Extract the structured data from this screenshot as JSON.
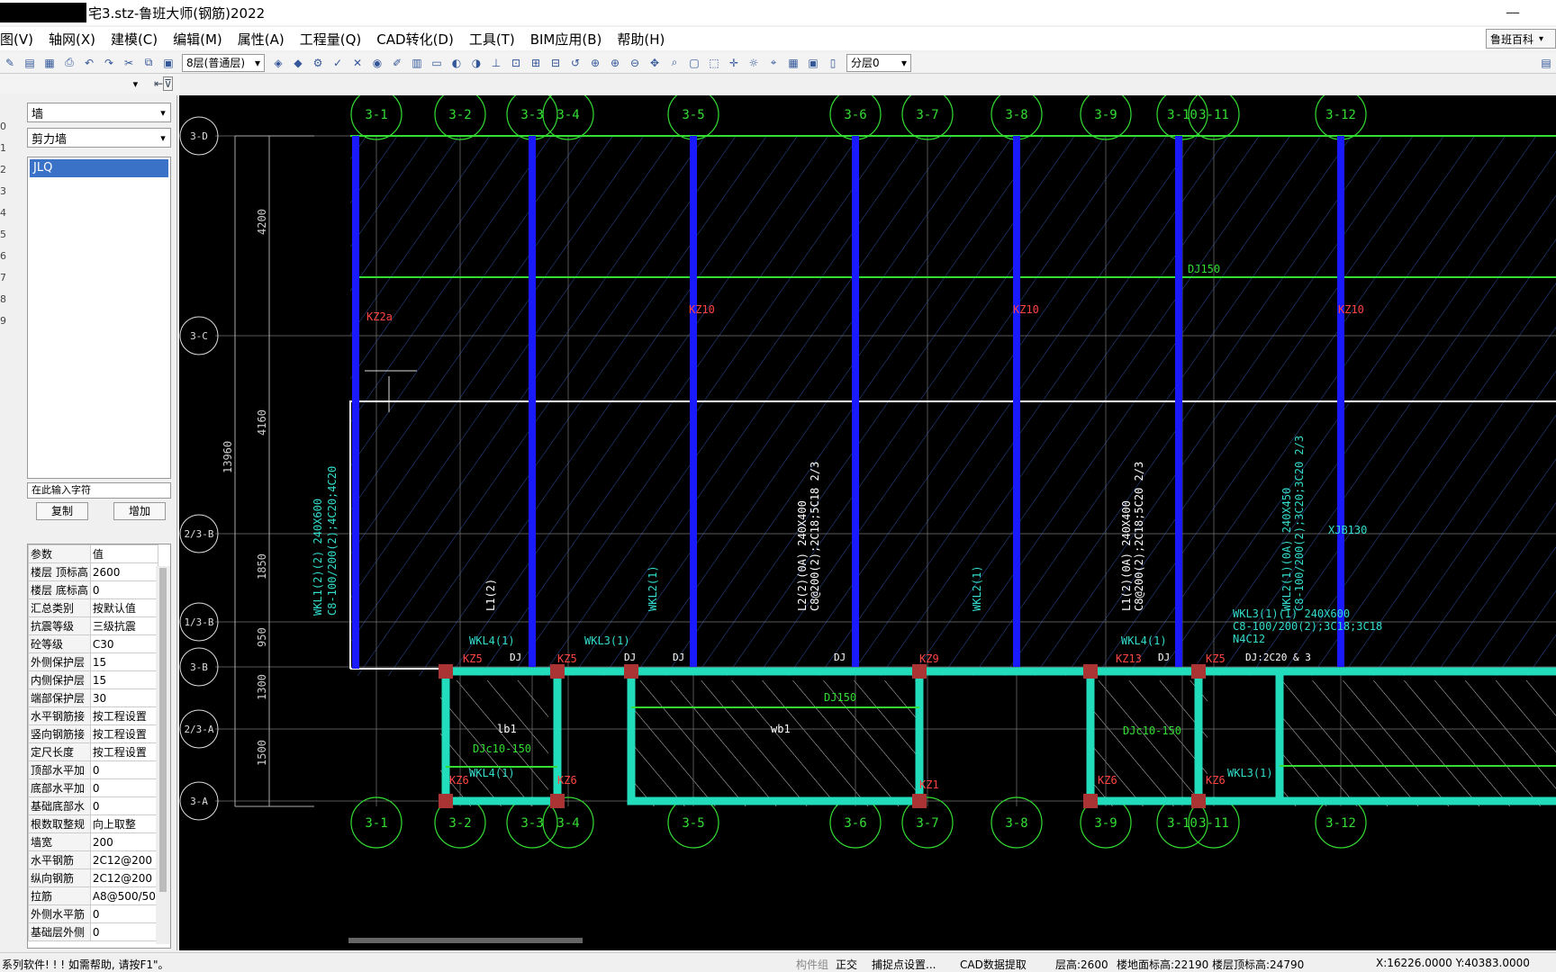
{
  "window": {
    "title": "宅3.stz-鲁班大师(钢筋)2022",
    "minimize": "—"
  },
  "menu": [
    "图(V)",
    "轴网(X)",
    "建模(C)",
    "编辑(M)",
    "属性(A)",
    "工程量(Q)",
    "CAD转化(D)",
    "工具(T)",
    "BIM应用(B)",
    "帮助(H)"
  ],
  "help_center": "鲁班百科",
  "toolbar": {
    "floor": "8层(普通层)",
    "layer": "分层0"
  },
  "left_strip": [
    "0",
    "1",
    "2",
    "3",
    "4",
    "5",
    "6",
    "7",
    "8",
    "9"
  ],
  "panel": {
    "type": "墙",
    "subtype": "剪力墙",
    "selected_item": "JLQ",
    "search_placeholder": "在此输入字符",
    "copy_btn": "复制",
    "add_btn": "增加",
    "props_header": [
      "参数",
      "值"
    ],
    "props": [
      [
        "楼层 顶标高",
        "2600"
      ],
      [
        "楼层 底标高",
        "0"
      ],
      [
        "汇总类别",
        "按默认值"
      ],
      [
        "抗震等级",
        "三级抗震"
      ],
      [
        "砼等级",
        "C30"
      ],
      [
        "外侧保护层",
        "15"
      ],
      [
        "内侧保护层",
        "15"
      ],
      [
        "端部保护层",
        "30"
      ],
      [
        "水平钢筋接",
        "按工程设置"
      ],
      [
        "竖向钢筋接",
        "按工程设置"
      ],
      [
        "定尺长度",
        "按工程设置"
      ],
      [
        "顶部水平加",
        "0"
      ],
      [
        "底部水平加",
        "0"
      ],
      [
        "基础底部水",
        "0"
      ],
      [
        "根数取整规",
        "向上取整"
      ],
      [
        "墙宽",
        "200"
      ],
      [
        "水平钢筋",
        "2C12@200"
      ],
      [
        "纵向钢筋",
        "2C12@200"
      ],
      [
        "拉筋",
        "A8@500/50"
      ],
      [
        "外侧水平筋",
        "0"
      ],
      [
        "基础层外侧",
        "0"
      ]
    ]
  },
  "cad": {
    "top_axes": [
      "3-1",
      "3-2",
      "3-3",
      "3-4",
      "3-5",
      "3-6",
      "3-7",
      "3-8",
      "3-9",
      "3-10",
      "3-11",
      "3-12"
    ],
    "left_axes": [
      "3-D",
      "3-C",
      "2/3-B",
      "1/3-B",
      "3-B",
      "2/3-A",
      "3-A"
    ],
    "dims": [
      "4200",
      "4160",
      "13960",
      "1850",
      "950",
      "1300",
      "1500"
    ],
    "labels": {
      "dj150": "DJ150",
      "kz2a": "KZ2a",
      "kz10": "KZ10",
      "xjb130": "XJB130",
      "wkl1": "WKL1(2)(2) 240X600",
      "wkl1b": "C8-100/200(2);4C20;4C20",
      "l1": "L1(2)",
      "wkl2": "WKL2(1)",
      "l2": "L2(2)(0A) 240X400",
      "l2b": "C8@200(2);2C18;5C18 2/3",
      "l1b": "L1(2)(0A) 240X400",
      "l1c": "C8@200(2);2C18;5C20 2/3",
      "wkl2b": "WKL2(1)(0A) 240X450",
      "wkl2c": "C8-100/200(2);3C20;3C20 2/3",
      "wkl3": "WKL3(1)(1) 240X600",
      "wkl3b": "C8-100/200(2);3C18;3C18",
      "n4c12": "N4C12",
      "wkl4": "WKL4(1)",
      "wkl3s": "WKL3(1)",
      "kz5": "KZ5",
      "kz6": "KZ6",
      "kz9": "KZ9",
      "kz1": "KZ1",
      "kz13": "KZ13",
      "dj": "DJ",
      "dj2": "DJ:2C20 & 3",
      "lb1": "lb1",
      "wb1": "wb1",
      "djc": "DJc10-150",
      "djc2": "DJc10-150"
    }
  },
  "status": {
    "msg": "系列软件! ! !   如需帮助, 请按F1\"。",
    "group": "构件组",
    "ortho": "正交",
    "snap": "捕捉点设置...",
    "cad_extract": "CAD数据提取",
    "floor_h": "层高:2600",
    "floor_elev": "楼地面标高:22190",
    "floor_top": "楼层顶标高:24790",
    "coords": "X:16226.0000 Y:40383.0000"
  }
}
